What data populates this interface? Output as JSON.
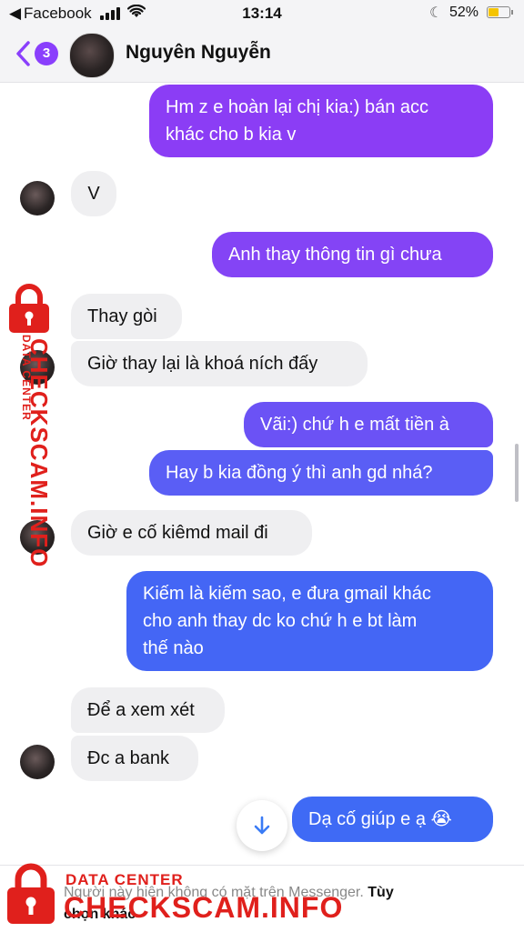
{
  "status_bar": {
    "back_label": "Facebook",
    "time": "13:14",
    "battery": "52%",
    "battery_level": 0.52
  },
  "header": {
    "badge_count": "3",
    "contact_name": "Nguyên Nguyễn"
  },
  "messages": [
    {
      "direction": "out",
      "lines": [
        "Hm z e hoàn lại chị kia:) bán acc",
        "khác cho b kia v"
      ]
    },
    {
      "direction": "in",
      "lines": [
        "V"
      ]
    },
    {
      "direction": "out",
      "lines": [
        "Anh thay thông tin gì chưa"
      ]
    },
    {
      "direction": "in",
      "lines": [
        "Thay gòi"
      ]
    },
    {
      "direction": "in",
      "lines": [
        "Giờ thay lại là khoá ních đấy"
      ]
    },
    {
      "direction": "out",
      "lines": [
        "Vãi:) chứ h e mất tiền à"
      ]
    },
    {
      "direction": "out",
      "lines": [
        "Hay b kia đồng ý thì anh gd nhá?"
      ]
    },
    {
      "direction": "in",
      "lines": [
        "Giờ e cố kiêmd mail đi"
      ]
    },
    {
      "direction": "out",
      "lines": [
        "Kiếm là kiếm sao, e đưa gmail khác",
        "cho anh thay dc ko chứ h e bt làm",
        "thế nào"
      ]
    },
    {
      "direction": "in",
      "lines": [
        "Để a xem xét"
      ]
    },
    {
      "direction": "in",
      "lines": [
        "Đc a bank"
      ]
    },
    {
      "direction": "out",
      "lines": [
        "Dạ cố giúp e ạ 😭"
      ]
    }
  ],
  "footer": {
    "notice": "Người này hiện không có mặt trên Messenger.",
    "action_line1": "Tùy",
    "action_line2": "chọn khác"
  },
  "watermark": {
    "small_text": "DATA CENTER",
    "big_text": "CHECKSCAM.INFO"
  },
  "colors": {
    "accent": "#8a3ffc",
    "bubble_out_top": "#8b3df5",
    "bubble_out_bottom": "#3f6af5",
    "bubble_in": "#efeff1",
    "watermark": "#e0201c"
  }
}
